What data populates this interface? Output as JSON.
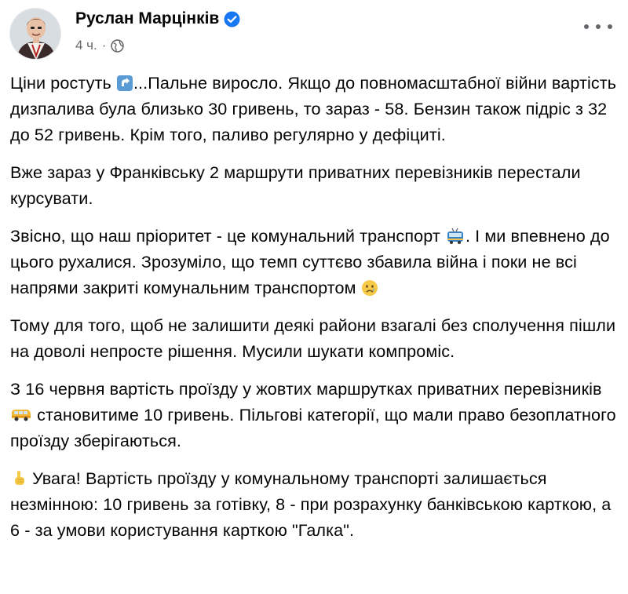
{
  "post": {
    "author": "Руслан Марцінків",
    "time": "4 ч.",
    "paragraphs": [
      {
        "parts": [
          {
            "text": "Ціни ростуть "
          },
          {
            "emoji": "arrow-up-emoji"
          },
          {
            "text": "...Пальне виросло. Якщо до повномасштабної війни вартість дизпалива була близько 30 гривень, то зараз - 58. Бензин також підріс з 32 до 52 гривень. Крім того, паливо регулярно у дефіциті."
          }
        ]
      },
      {
        "parts": [
          {
            "text": "Вже зараз у Франківську 2 маршрути приватних перевізників перестали курсувати."
          }
        ]
      },
      {
        "parts": [
          {
            "text": "Звісно, що наш пріоритет -  це комунальний транспорт "
          },
          {
            "emoji": "trolleybus-emoji"
          },
          {
            "text": ". І ми впевнено до цього рухалися. Зрозуміло, що темп суттєво збавила війна і поки не всі напрями закриті комунальним транспортом "
          },
          {
            "emoji": "sad-face-emoji"
          }
        ]
      },
      {
        "parts": [
          {
            "text": "Тому для того, щоб не залишити деякі райони взагалі без сполучення пішли на доволі непросте рішення. Мусили шукати компроміс."
          }
        ]
      },
      {
        "parts": [
          {
            "text": "З 16 червня вартість проїзду у жовтих маршрутках приватних перевізників "
          },
          {
            "emoji": "minibus-emoji"
          },
          {
            "text": " становитиме 10 гривень. Пільгові категорії, що мали право безоплатного проїзду зберігаються."
          }
        ]
      },
      {
        "parts": [
          {
            "emoji": "pointing-up-emoji"
          },
          {
            "text": " Увага! Вартість проїзду у комунальному транспорті залишається незмінною: 10 гривень за готівку,  8 - при розрахунку банківською карткою, а 6 - за умови користування карткою \"Галка\"."
          }
        ]
      }
    ]
  },
  "colors": {
    "text": "#050505",
    "secondary": "#65676b",
    "verified": "#1877f2"
  }
}
